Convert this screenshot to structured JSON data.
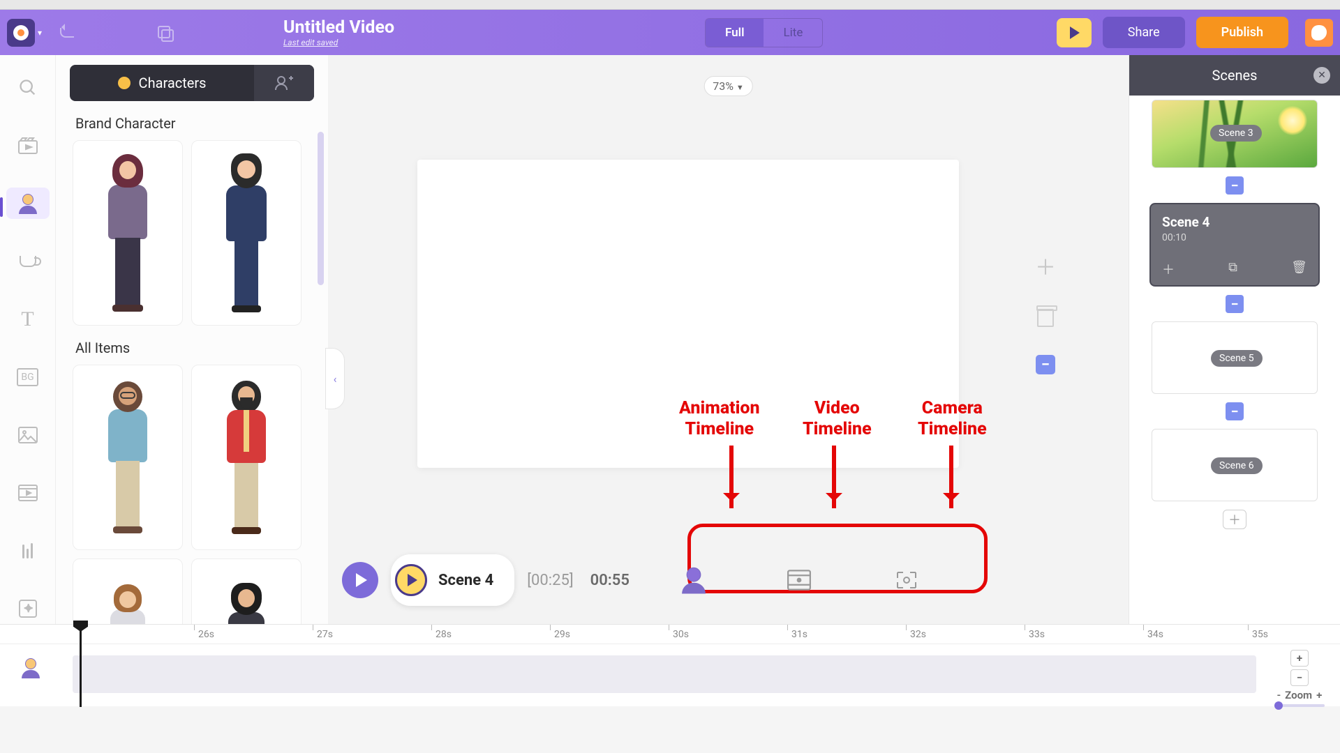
{
  "header": {
    "title": "Untitled Video",
    "subtitle": "Last edit saved",
    "mode_full": "Full",
    "mode_lite": "Lite",
    "share": "Share",
    "publish": "Publish"
  },
  "library": {
    "tab_label": "Characters",
    "section_brand": "Brand Character",
    "section_all": "All Items"
  },
  "canvas": {
    "zoom": "73%",
    "collapse_glyph": "‹"
  },
  "annotations": {
    "anim_l1": "Animation",
    "anim_l2": "Timeline",
    "vid_l1": "Video",
    "vid_l2": "Timeline",
    "cam_l1": "Camera",
    "cam_l2": "Timeline"
  },
  "playbar": {
    "scene": "Scene 4",
    "time_current": "[00:25]",
    "time_total": "00:55"
  },
  "scenes": {
    "title": "Scenes",
    "s3": "Scene 3",
    "s4": "Scene 4",
    "s4_dur": "00:10",
    "s5": "Scene 5",
    "s6": "Scene 6"
  },
  "timeline": {
    "ticks": [
      "26s",
      "27s",
      "28s",
      "29s",
      "30s",
      "31s",
      "32s",
      "33s",
      "34s",
      "35s"
    ],
    "zoom_label": "Zoom"
  }
}
